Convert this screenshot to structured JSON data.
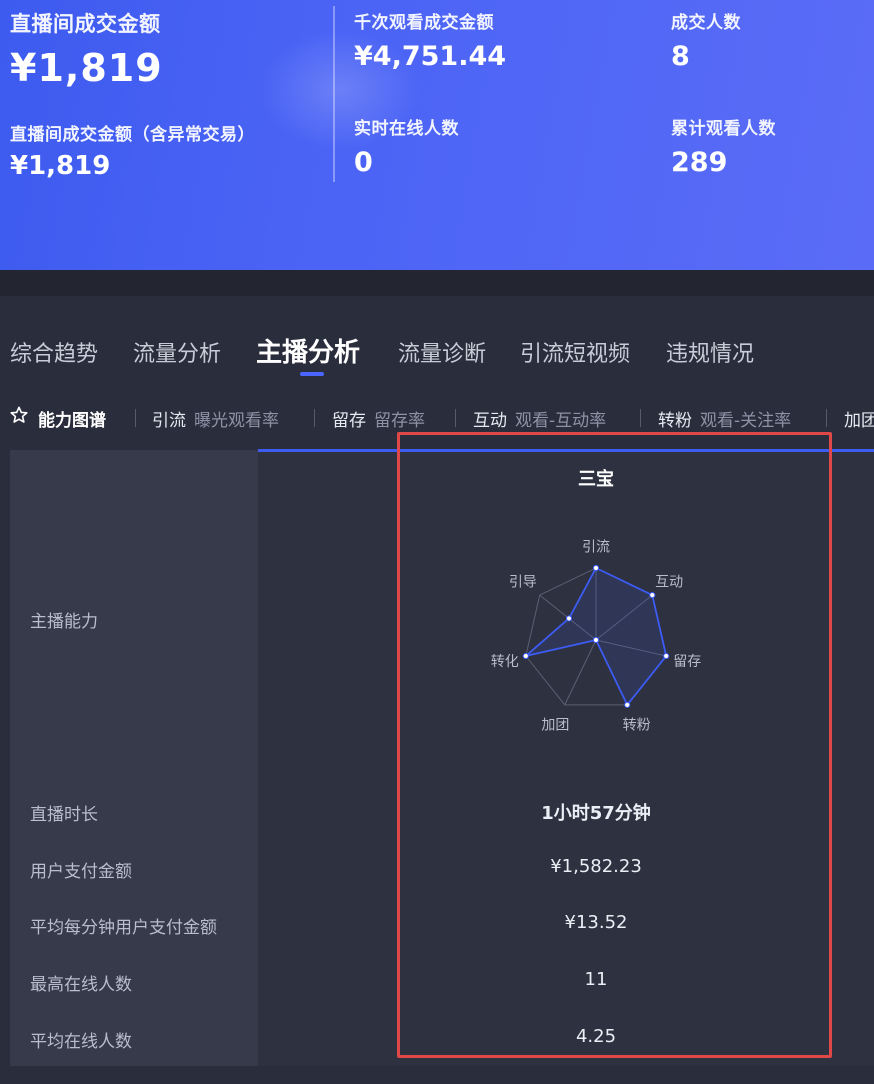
{
  "banner": {
    "gmv_label": "直播间成交金额",
    "gmv_value": "¥1,819",
    "gmv_incl_label": "直播间成交金额（含异常交易）",
    "gmv_incl_value": "¥1,819",
    "gpm_label": "千次观看成交金额",
    "gpm_value": "¥4,751.44",
    "online_label": "实时在线人数",
    "online_value": "0",
    "buyers_label": "成交人数",
    "buyers_value": "8",
    "viewers_label": "累计观看人数",
    "viewers_value": "289"
  },
  "tabs": [
    {
      "label": "综合趋势"
    },
    {
      "label": "流量分析"
    },
    {
      "label": "主播分析",
      "active": true
    },
    {
      "label": "流量诊断"
    },
    {
      "label": "引流短视频"
    },
    {
      "label": "违规情况"
    }
  ],
  "subtabs": {
    "ability": "能力图谱",
    "items": [
      {
        "key": "引流",
        "value": "曝光观看率"
      },
      {
        "key": "留存",
        "value": "留存率"
      },
      {
        "key": "互动",
        "value": "观看-互动率"
      },
      {
        "key": "转粉",
        "value": "观看-关注率"
      },
      {
        "key": "加团",
        "value": ""
      }
    ]
  },
  "table": {
    "anchor_name": "三宝",
    "ability_label": "主播能力",
    "rows": [
      {
        "label": "直播时长",
        "value": "1小时57分钟"
      },
      {
        "label": "用户支付金额",
        "value": "¥1,582.23"
      },
      {
        "label": "平均每分钟用户支付金额",
        "value": "¥13.52"
      },
      {
        "label": "最高在线人数",
        "value": "11"
      },
      {
        "label": "平均在线人数",
        "value": "4.25"
      }
    ]
  },
  "radar": {
    "axes": [
      "引流",
      "互动",
      "留存",
      "转粉",
      "加团",
      "转化",
      "引导"
    ],
    "values": [
      1.0,
      1.0,
      1.0,
      1.0,
      0.0,
      1.0,
      0.48
    ],
    "line_color": "#3d5cf5",
    "grid_color": "#5a5f72"
  },
  "colors": {
    "banner": "#4a63f5",
    "accent": "#4a66ff",
    "highlight": "#e04848"
  }
}
